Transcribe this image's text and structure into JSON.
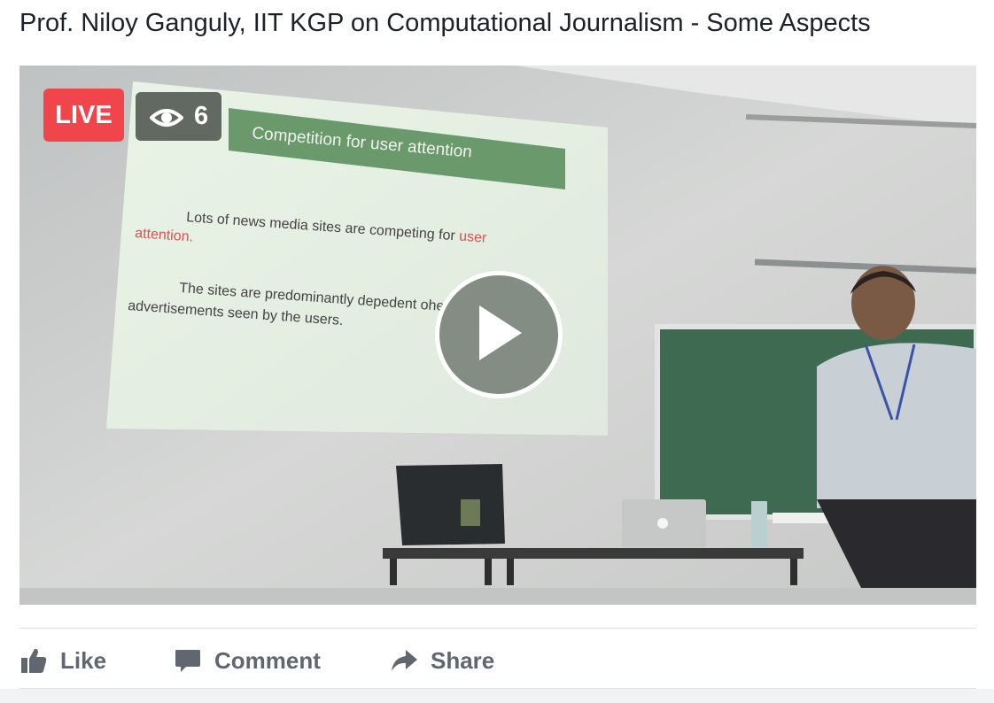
{
  "post": {
    "title": "Prof. Niloy Ganguly, IIT KGP on Computational Journalism - Some Aspects"
  },
  "video": {
    "live_label": "LIVE",
    "viewer_count": "6",
    "slide": {
      "heading": "Competition for user attention",
      "line1a": "Lots of news media sites are competing for",
      "line1b": "user",
      "line1c": "attention.",
      "line2a": "The sites are predominantly depe",
      "line2b": "dent o",
      "line2c": "he",
      "line2d": "advertisements seen by the users."
    }
  },
  "actions": {
    "like_label": "Like",
    "comment_label": "Comment",
    "share_label": "Share"
  },
  "colors": {
    "live_badge": "#f0454b",
    "action_text": "#606770",
    "slide_heading_bg": "#6a9a6c"
  },
  "icons": {
    "viewer": "eye-icon",
    "play": "play-icon",
    "like": "thumbs-up-icon",
    "comment": "speech-bubble-icon",
    "share": "share-arrow-icon"
  }
}
